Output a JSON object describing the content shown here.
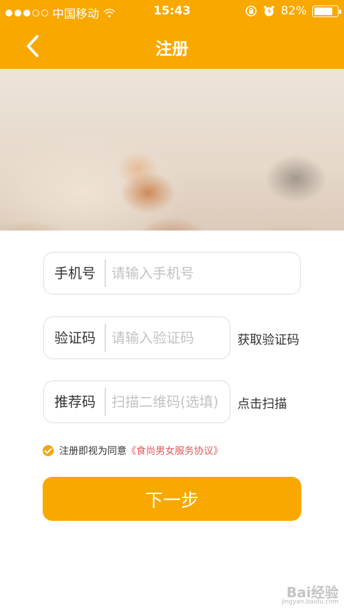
{
  "status_bar": {
    "carrier": "中国移动",
    "time": "15:43",
    "battery": "82%",
    "battery_level": 0.82
  },
  "navbar": {
    "title": "注册"
  },
  "form": {
    "phone": {
      "label": "手机号",
      "placeholder": "请输入手机号"
    },
    "code": {
      "label": "验证码",
      "placeholder": "请输入验证码",
      "action": "获取验证码"
    },
    "referral": {
      "label": "推荐码",
      "placeholder": "扫描二维码(选填)",
      "action": "点击扫描"
    }
  },
  "agreement": {
    "text": "注册即视为同意",
    "link": "《食尚男女服务协议》"
  },
  "next_button": "下一步",
  "watermark": {
    "main": "Bai经验",
    "sub": "jingyan.baidu.com"
  },
  "colors": {
    "primary": "#f9a800",
    "link": "#e05858",
    "border": "#dcdcdc",
    "placeholder": "#c2c2c2"
  }
}
